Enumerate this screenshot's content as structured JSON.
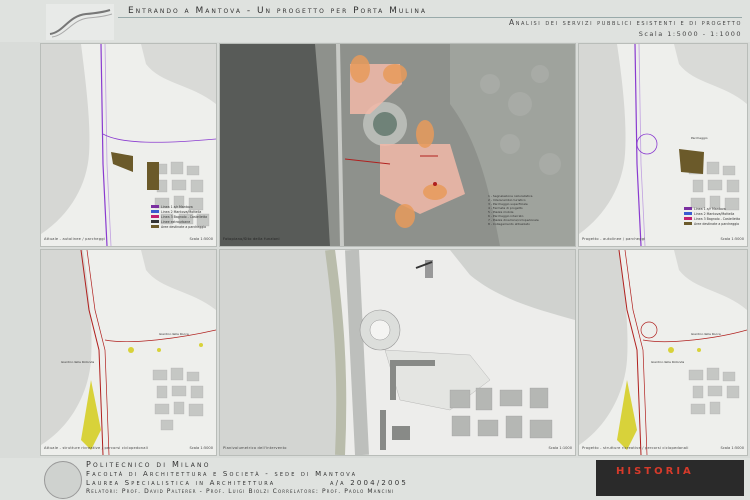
{
  "header": {
    "title": "Entrando a Mantova - Un progetto per Porta Mulina",
    "subtitle": "Analisi dei servizi pubblici esistenti e di progetto",
    "scale": "Scala 1:5000 - 1:1000"
  },
  "panels": {
    "top_left": {
      "caption_left": "Attuale - autolinee / parcheggi",
      "caption_right": "Scala 1:5000",
      "legend": [
        {
          "label": "Linea 1 a/r Mantova",
          "color": "#7a2fa0"
        },
        {
          "label": "Linea 2 Mantova/Mottella",
          "color": "#3b5bd0"
        },
        {
          "label": "Linea 3 Bagnolo - Castelletta",
          "color": "#c02070"
        },
        {
          "label": "Linee extraurbane",
          "color": "#333333"
        },
        {
          "label": "Aree destinate a parcheggio",
          "color": "#6b5a2a"
        }
      ]
    },
    "top_center": {
      "caption_left": "Fotopiano/Sito della funzioni",
      "legend": [
        "1 - Segnalazione naturalistica",
        "2 - Interscambio turistico",
        "3 - Parcheggio superficiale",
        "4 - Fermata di progetto",
        "5 - Piazza mobile",
        "6 - Parcheggio interrato",
        "7 - Piazza dinamica/ciclopedonale",
        "8 - Collegamento attrezzato"
      ]
    },
    "top_right": {
      "caption_left": "Progetto - autolinee / parcheggi",
      "caption_right": "Scala 1:5000",
      "label": "Parcheggio",
      "legend": [
        {
          "label": "Linea 1 a/r Mantova",
          "color": "#7a2fa0"
        },
        {
          "label": "Linea 2 Mantova/Mottella",
          "color": "#3b5bd0"
        },
        {
          "label": "Linea 3 Bagnolo - Castelletta",
          "color": "#c02070"
        },
        {
          "label": "Aree destinate a parcheggio",
          "color": "#6b5a2a"
        }
      ]
    },
    "bottom_left": {
      "caption_left": "Attuale - strutture ricreative / percorsi ciclopedonali",
      "caption_right": "Scala 1:5000",
      "labels": [
        "Giardini della Rocca",
        "Giardini della Rotonda"
      ]
    },
    "bottom_center": {
      "caption_left": "Planivolumetrico dell'intervento",
      "caption_right": "Scala 1:1000"
    },
    "bottom_right": {
      "caption_left": "Progetto - strutture ricreative / percorsi ciclopedonali",
      "caption_right": "Scala 1:5000",
      "labels": [
        "Giardini della Rocca",
        "Giardini della Rotonda"
      ]
    }
  },
  "footer": {
    "line1": "Politecnico di Milano",
    "line2": "Facoltà di Architettura e Società - sede di Mantova",
    "line3": "Laurea Specialistica in Architettura",
    "year": "a/a 2004/2005",
    "line4": "Relatori: Prof. David Palterer - Prof. Luigi Biolzi  Correlatore: Prof. Paolo Mancini",
    "logo_text": "HISTORIA"
  },
  "colors": {
    "water": "#d3d5d2",
    "lake_photo": "#555855",
    "purple_route": "#8a3bd0",
    "red_route": "#b0201e",
    "parking": "#6b5a2a",
    "highlight": "#f2b8a8",
    "orange": "#e89a5a",
    "yellow": "#d8d23a"
  }
}
